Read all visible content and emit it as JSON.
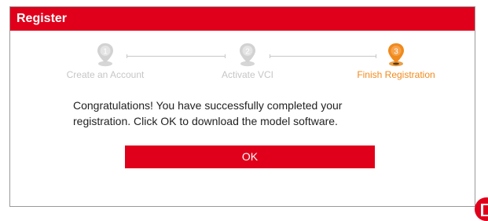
{
  "dialog": {
    "title": "Register"
  },
  "steps": [
    {
      "number": "1",
      "label": "Create an Account",
      "state": "done",
      "icon": "step-pin-icon"
    },
    {
      "number": "2",
      "label": "Activate VCI",
      "state": "done",
      "icon": "step-pin-icon"
    },
    {
      "number": "3",
      "label": "Finish Registration",
      "state": "active",
      "icon": "step-pin-icon"
    }
  ],
  "message": {
    "line1": "Congratulations! You have successfully completed your",
    "line2": "registration. Click OK to download the model software."
  },
  "ok_button": {
    "label": "OK"
  },
  "colors": {
    "brand_red": "#e0001b",
    "active_orange": "#f08a1c",
    "inactive_gray": "#c6c6c6"
  },
  "corner_icon": "app-logo-icon"
}
